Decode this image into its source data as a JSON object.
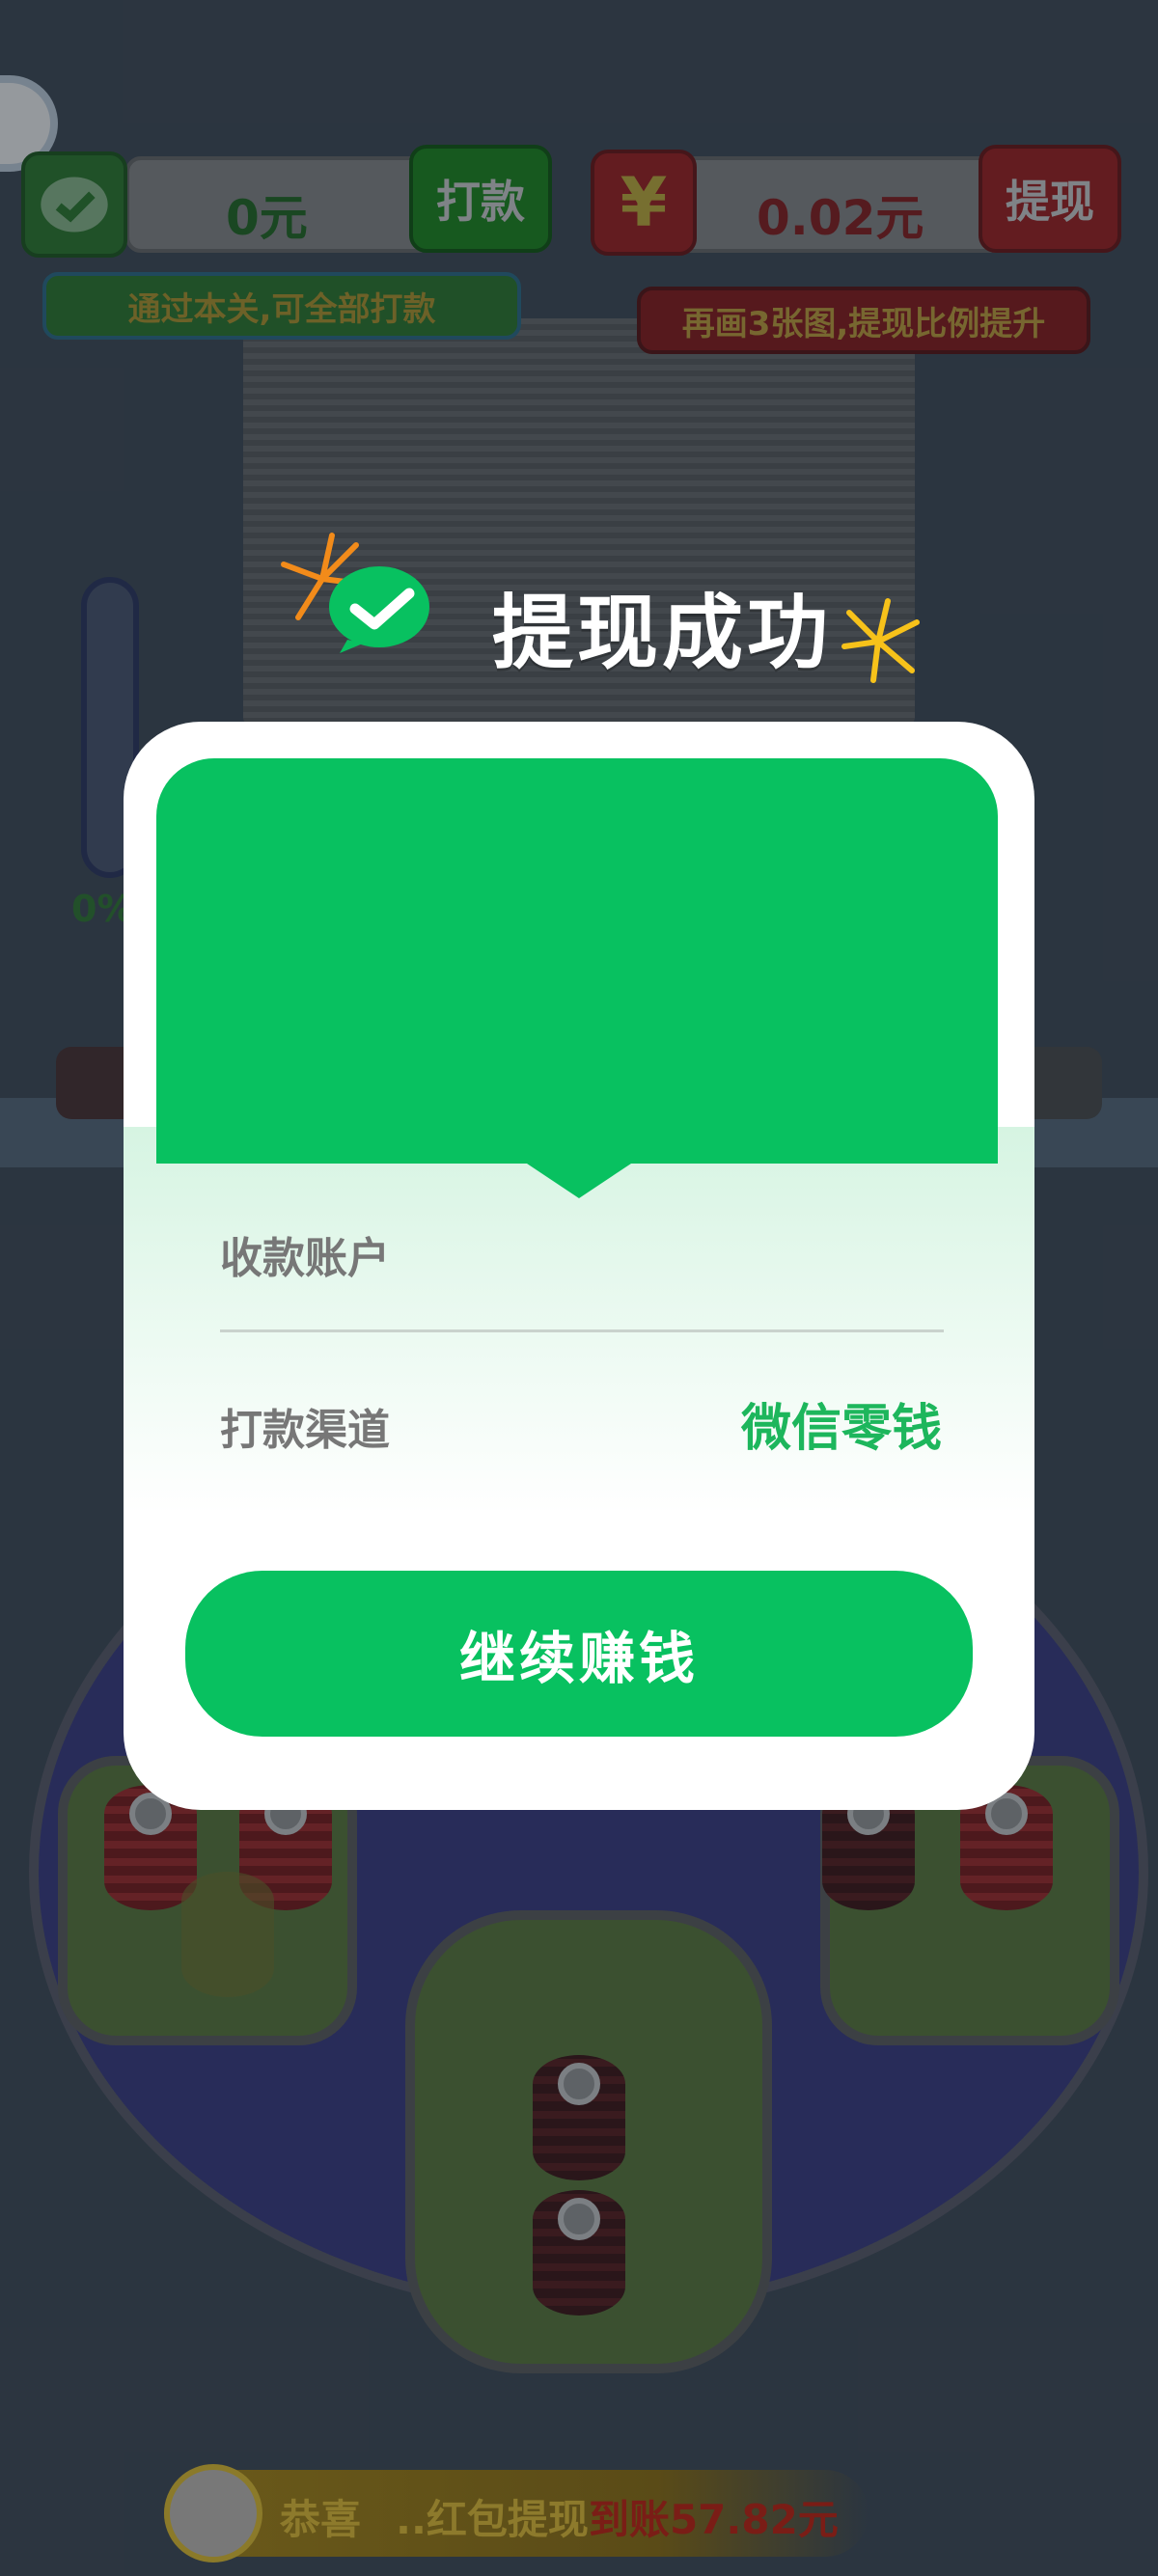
{
  "hud": {
    "left_amount": "0元",
    "left_button": "打款",
    "left_tip": "通过本关,可全部打款",
    "right_icon_symbol": "¥",
    "right_amount": "0.02元",
    "right_button": "提现",
    "right_tip": "再画3张图,提现比例提升"
  },
  "game": {
    "progress_percent": "0%"
  },
  "dialog": {
    "title": "提现成功",
    "account_label": "收款账户",
    "account_value": "",
    "channel_label": "打款渠道",
    "channel_value": "微信零钱",
    "continue_button": "继续赚钱"
  },
  "ticker": {
    "prefix": "恭喜",
    "middle": "..红包提现",
    "amount": "到账57.82元"
  },
  "colors": {
    "wechat_green": "#08c160",
    "hud_red": "#c01c1c",
    "hud_green": "#1b9a1b"
  }
}
